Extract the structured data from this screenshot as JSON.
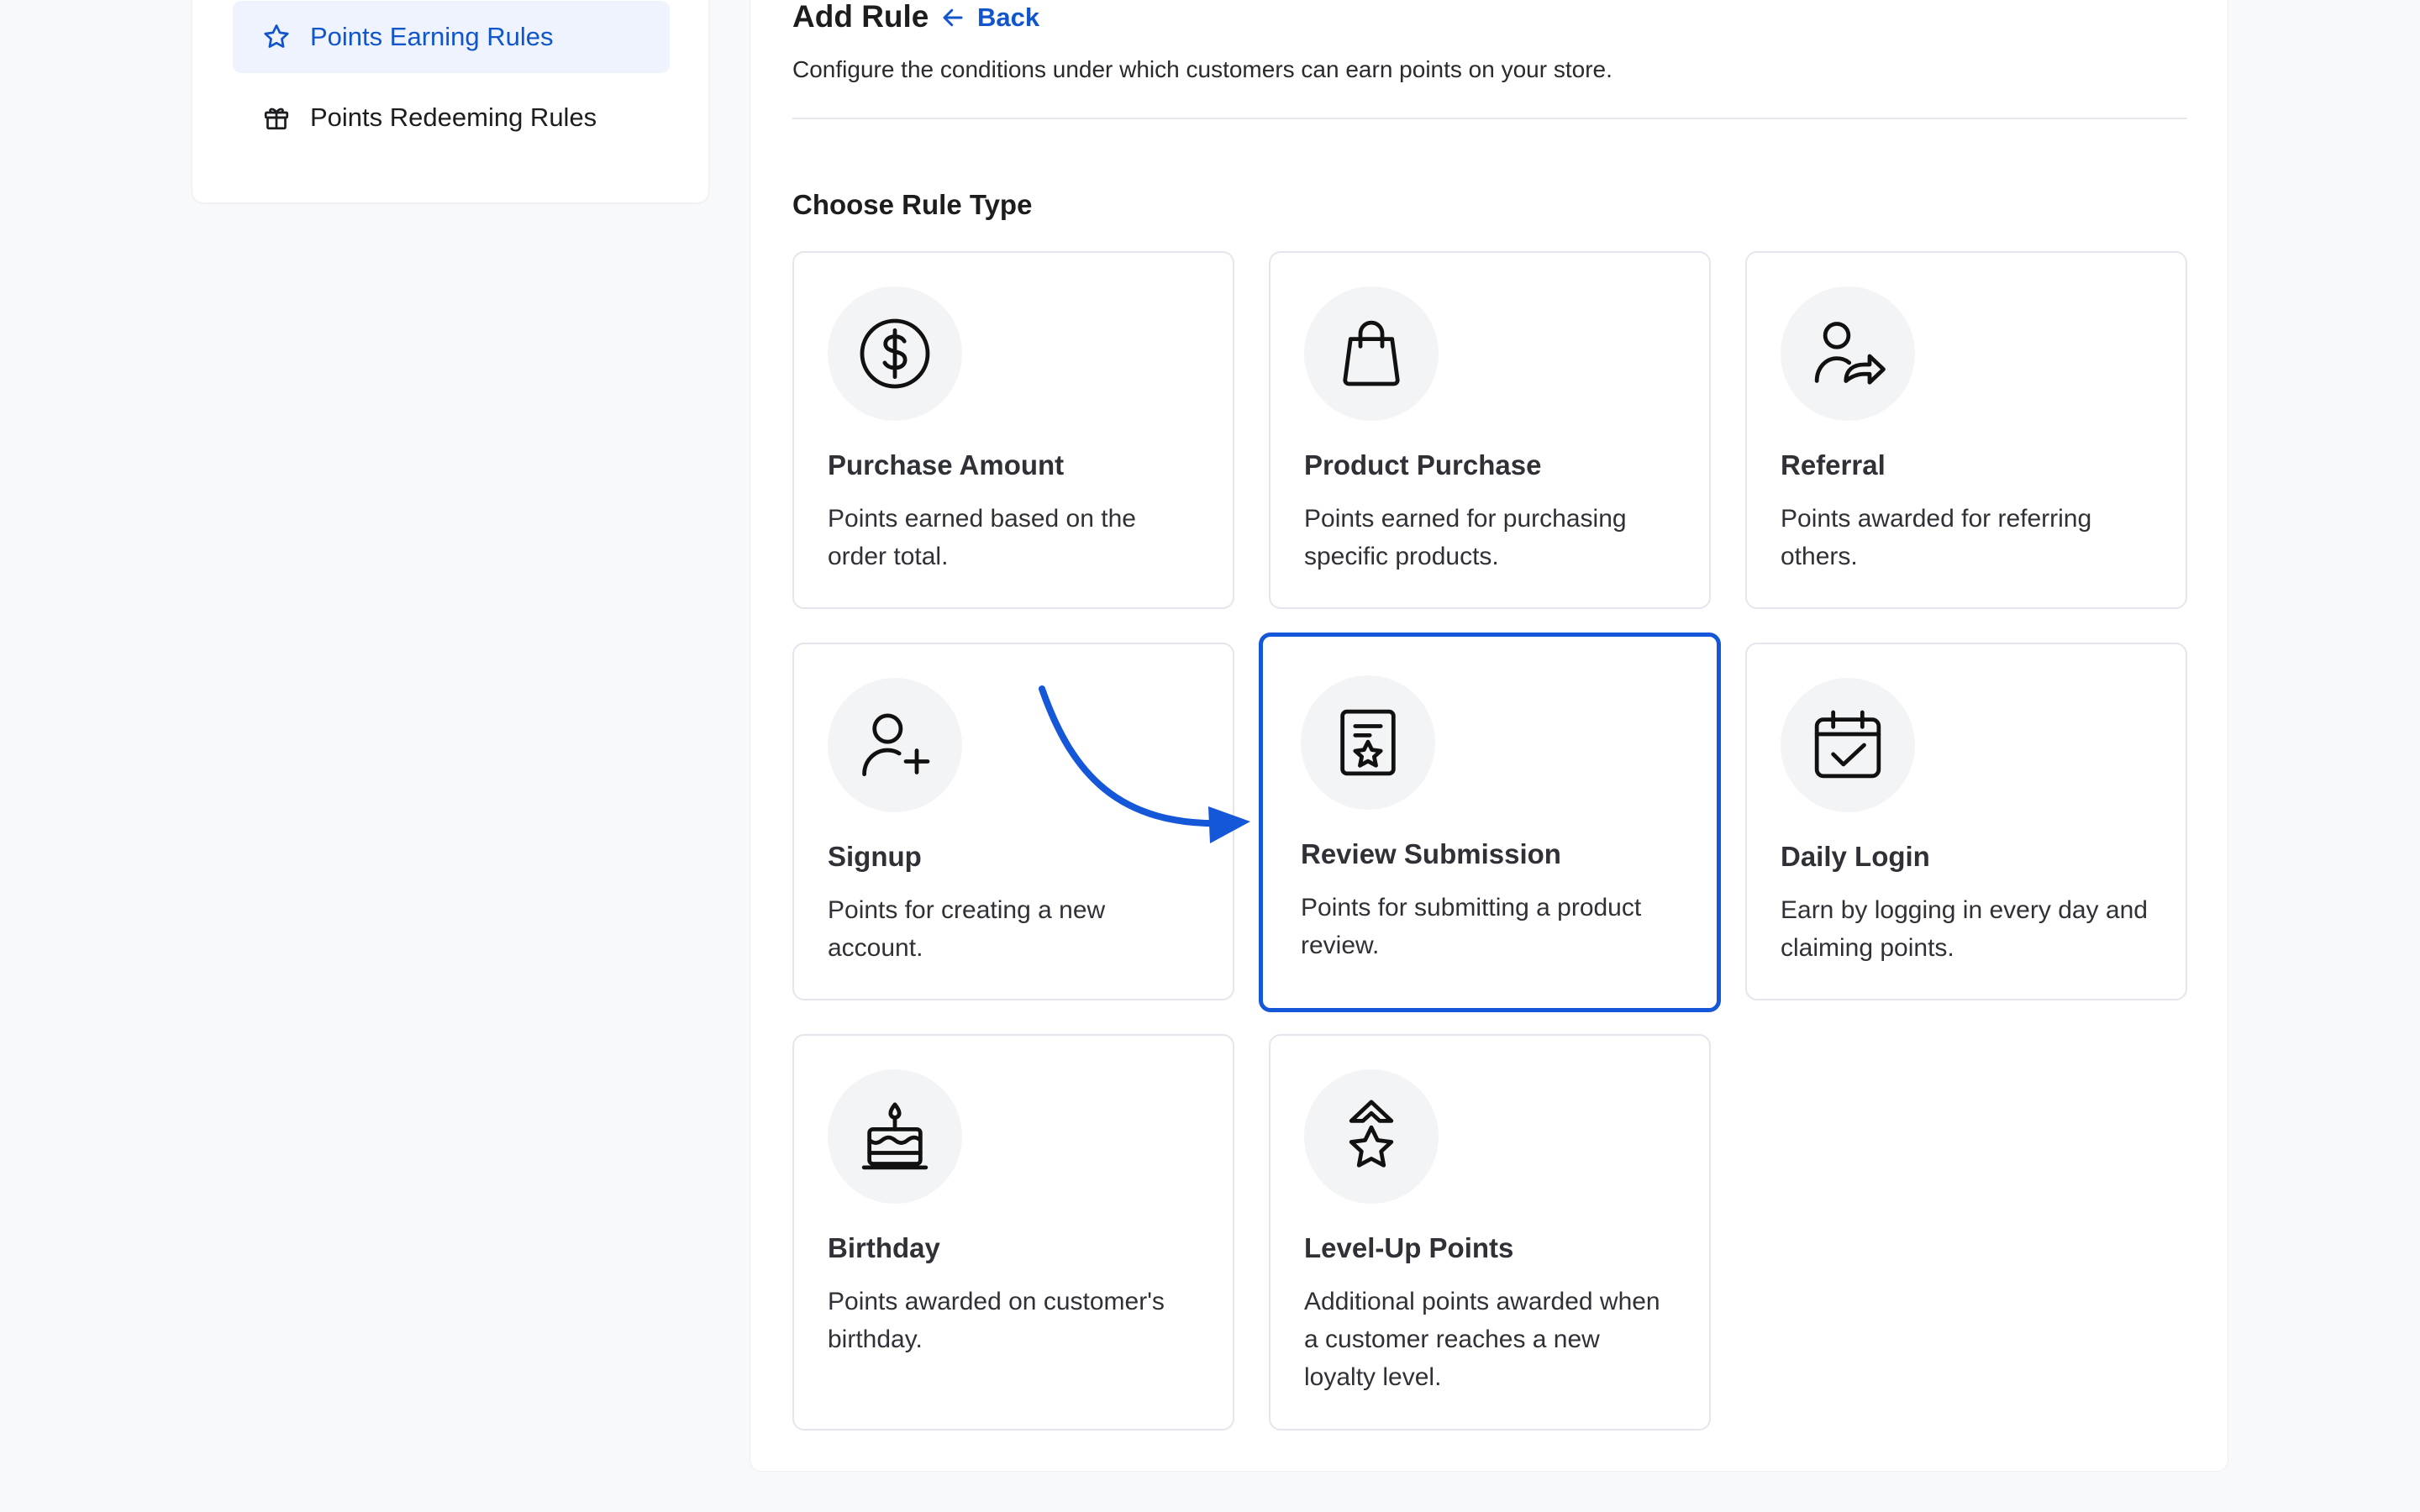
{
  "sidebar": {
    "items": [
      {
        "label": "Points Earning Rules",
        "icon": "star-icon",
        "active": true
      },
      {
        "label": "Points Redeeming Rules",
        "icon": "gift-icon",
        "active": false
      }
    ]
  },
  "header": {
    "title": "Add Rule",
    "back_label": "Back",
    "subtitle": "Configure the conditions under which customers can earn points on your store."
  },
  "section_title": "Choose Rule Type",
  "rule_types": [
    {
      "title": "Purchase Amount",
      "description": "Points earned based on the order total.",
      "icon": "dollar-circle-icon"
    },
    {
      "title": "Product Purchase",
      "description": "Points earned for purchasing specific products.",
      "icon": "shopping-bag-icon"
    },
    {
      "title": "Referral",
      "description": "Points awarded for referring others.",
      "icon": "user-share-icon"
    },
    {
      "title": "Signup",
      "description": "Points for creating a new account.",
      "icon": "user-plus-icon"
    },
    {
      "title": "Review Submission",
      "description": "Points for submitting a product review.",
      "icon": "review-star-icon",
      "selected": true
    },
    {
      "title": "Daily Login",
      "description": "Earn by logging in every day and claiming points.",
      "icon": "calendar-check-icon"
    },
    {
      "title": "Birthday",
      "description": "Points awarded on customer's birthday.",
      "icon": "birthday-cake-icon"
    },
    {
      "title": "Level-Up Points",
      "description": "Additional points awarded when a customer reaches a new loyalty level.",
      "icon": "level-up-star-icon"
    }
  ],
  "colors": {
    "accent": "#1457d9",
    "active_bg": "#eef3fe",
    "page_bg": "#f8f9fb"
  }
}
